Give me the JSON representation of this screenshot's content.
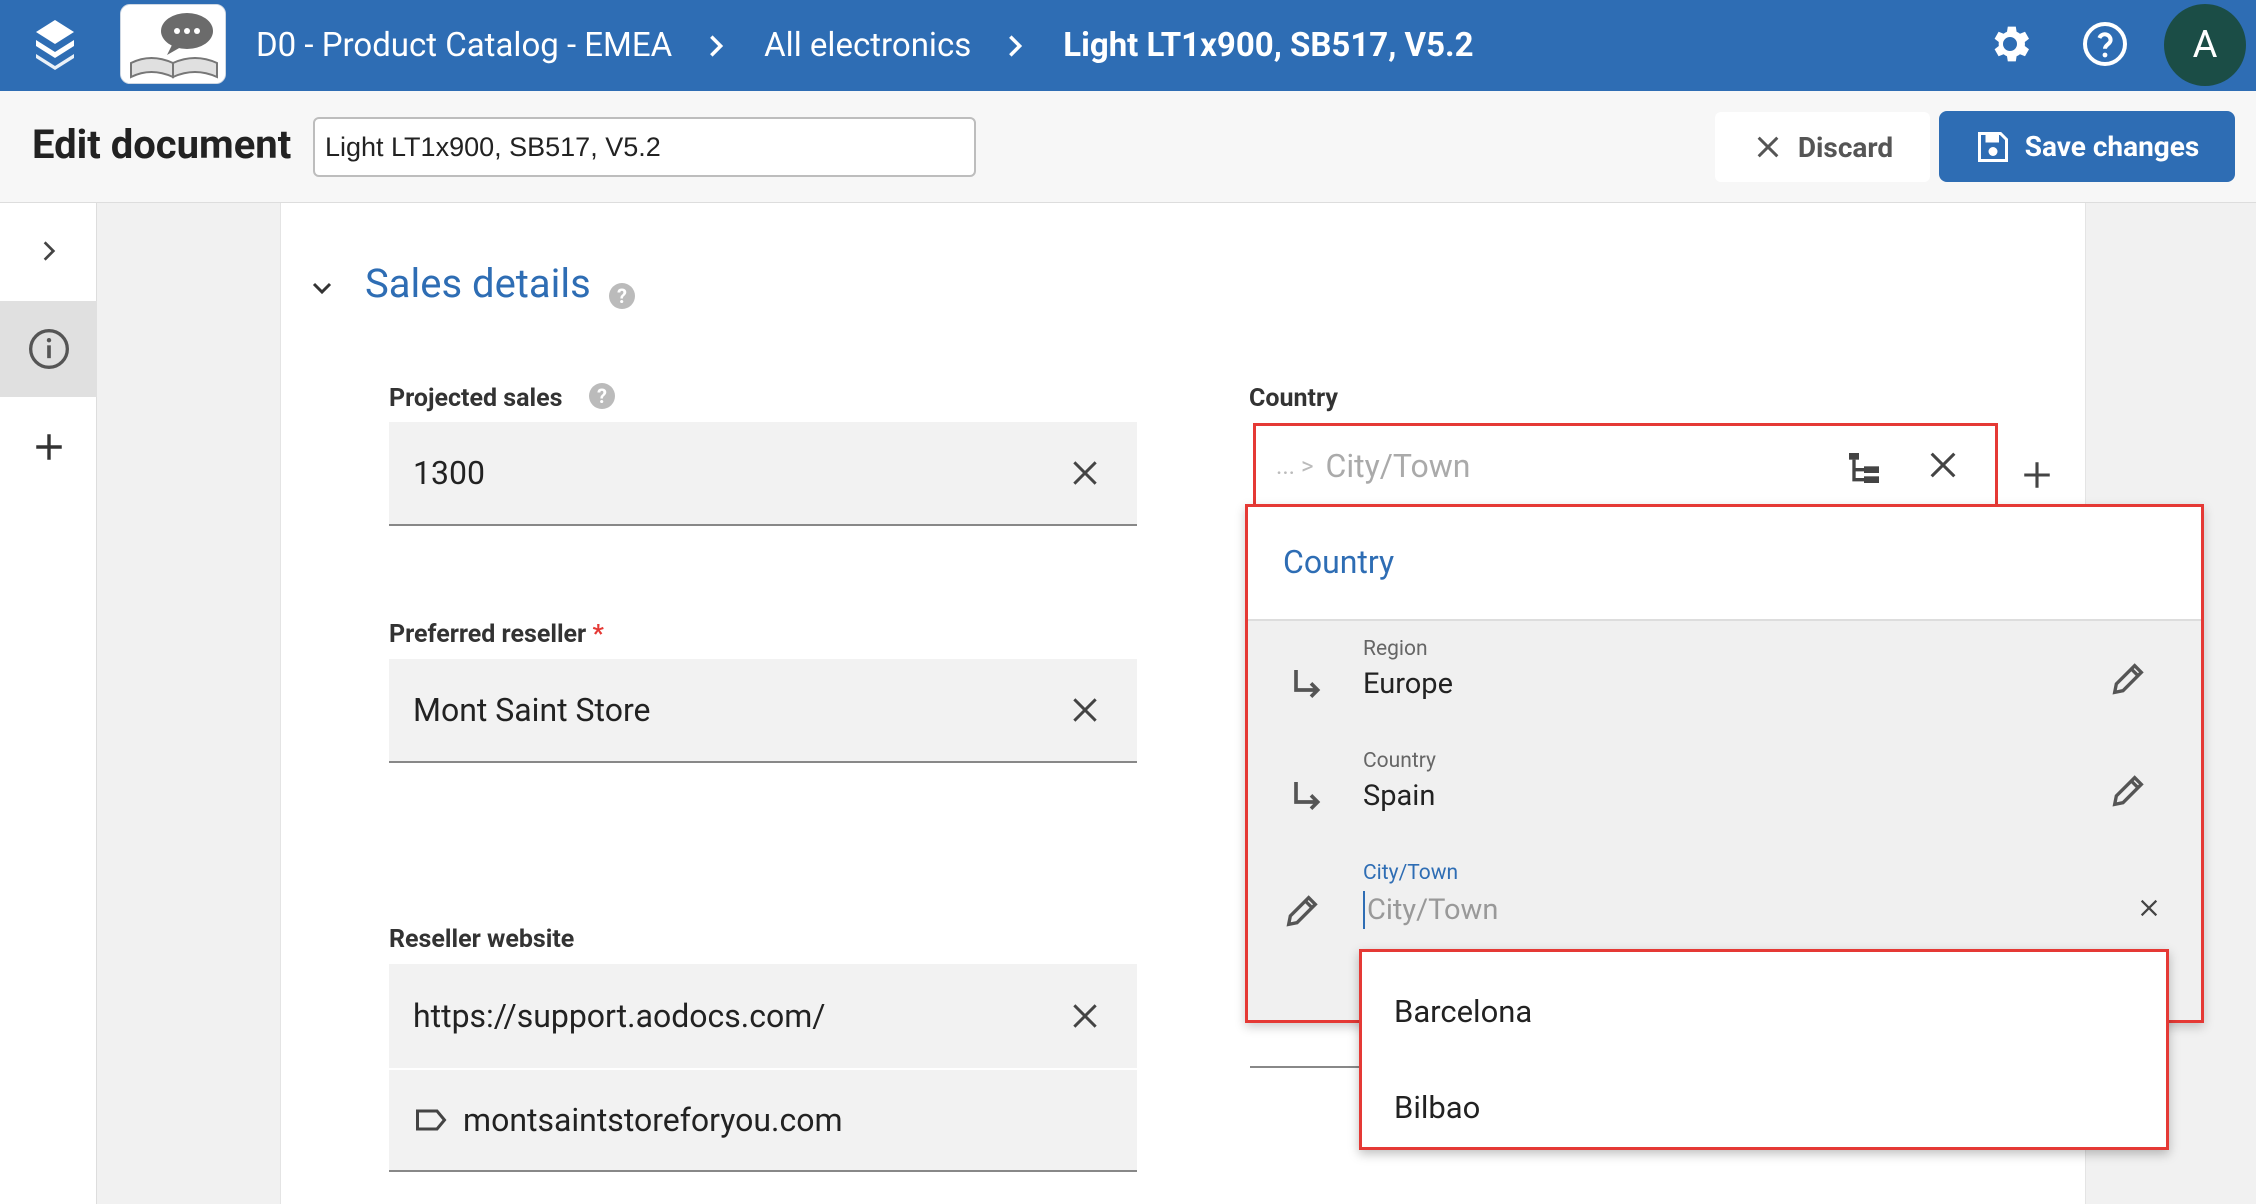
{
  "topbar": {
    "breadcrumb": [
      "D0 - Product Catalog - EMEA",
      "All electronics",
      "Light LT1x900, SB517, V5.2"
    ],
    "avatar_letter": "A"
  },
  "header": {
    "title": "Edit document",
    "document_name": "Light LT1x900, SB517, V5.2",
    "discard_label": "Discard",
    "save_label": "Save changes"
  },
  "section": {
    "title": "Sales details",
    "help": "?"
  },
  "fields": {
    "projected_sales": {
      "label": "Projected sales",
      "value": "1300",
      "help": "?"
    },
    "preferred_reseller": {
      "label": "Preferred reseller",
      "required_mark": "*",
      "value": "Mont Saint Store"
    },
    "reseller_website": {
      "label": "Reseller website",
      "value": "https://support.aodocs.com/",
      "display_text": "montsaintstoreforyou.com"
    },
    "country": {
      "label": "Country",
      "path_prefix": "... >",
      "placeholder": "City/Town"
    }
  },
  "country_popup": {
    "title": "Country",
    "levels": [
      {
        "label": "Region",
        "value": "Europe"
      },
      {
        "label": "Country",
        "value": "Spain"
      }
    ],
    "city": {
      "label": "City/Town",
      "placeholder": "City/Town"
    },
    "suggestions": [
      "Barcelona",
      "Bilbao"
    ]
  },
  "colors": {
    "brand_blue": "#2e6db4",
    "highlight_red": "#e53935",
    "avatar_green": "#1b4d46"
  }
}
